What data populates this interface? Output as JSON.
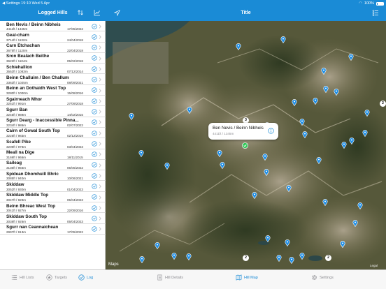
{
  "status_bar": {
    "back_app": "◀ Settings",
    "time": "19:10",
    "date": "Wed 5 Apr",
    "battery": "100%"
  },
  "left_panel": {
    "title": "Logged Hills",
    "sort_icon": "sort-arrows-icon",
    "chart_icon": "chart-icon",
    "hills": [
      {
        "name": "Ben Nevis / Beinn Nibheis",
        "height": "4411ft / 1345m",
        "date": "17/05/2022"
      },
      {
        "name": "Geal-charn",
        "height": "3714ft / 1132m",
        "date": "24/04/2018"
      },
      {
        "name": "Carn Etchachan",
        "height": "3675ft / 1120m",
        "date": "22/04/2018"
      },
      {
        "name": "Sron Bealach Beithe",
        "height": "3622ft / 1104m",
        "date": "05/02/2018"
      },
      {
        "name": "Schiehallion",
        "height": "3553ft / 1083m",
        "date": "07/12/2014"
      },
      {
        "name": "Beinn Challuim / Ben Challum",
        "height": "3363ft / 1025m",
        "date": "08/09/2021"
      },
      {
        "name": "Beinn an Dothaidh West Top",
        "height": "3280ft / 1000m",
        "date": "15/08/2016"
      },
      {
        "name": "Sgairneach Mhor",
        "height": "3251ft / 991m",
        "date": "27/09/2018"
      },
      {
        "name": "Sgurr Ban",
        "height": "3245ft / 989m",
        "date": "14/02/2015"
      },
      {
        "name": "Sgurr Dearg - Inaccessible Pinna...",
        "height": "3234ft / 986m",
        "date": "02/07/2022"
      },
      {
        "name": "Cairn of Gowal South Top",
        "height": "3225ft / 983m",
        "date": "02/12/2019"
      },
      {
        "name": "Scafell Pike",
        "height": "3209ft / 978m",
        "date": "03/04/2023"
      },
      {
        "name": "Meall na Dige",
        "height": "3169ft / 966m",
        "date": "18/11/2015"
      },
      {
        "name": "Saileag",
        "height": "3136ft / 956m",
        "date": "05/05/2022"
      },
      {
        "name": "Spidean Dhomhuill Bhric",
        "height": "3085ft / 940m",
        "date": "10/06/2021"
      },
      {
        "name": "Skiddaw",
        "height": "3052ft / 930m",
        "date": "01/04/2023"
      },
      {
        "name": "Skiddaw Middle Top",
        "height": "3047ft / 929m",
        "date": "05/04/2023"
      },
      {
        "name": "Beinn Bhreac West Top",
        "height": "3041ft / 927m",
        "date": "22/09/2016"
      },
      {
        "name": "Skiddaw South Top",
        "height": "3038ft / 926m",
        "date": "05/04/2023"
      },
      {
        "name": "Sgurr nan Ceannaichean",
        "height": "2997ft / 913m",
        "date": "17/05/2022"
      }
    ],
    "tabs": [
      {
        "label": "Hill Lists",
        "icon": "list-icon"
      },
      {
        "label": "Targets",
        "icon": "star-icon"
      },
      {
        "label": "Log",
        "icon": "checkmark-icon",
        "active": true
      }
    ]
  },
  "right_panel": {
    "title": "Title",
    "callout": {
      "name": "Ben Nevis / Beinn Nibheis",
      "height": "4411ft / 1345m"
    },
    "clusters": [
      "3",
      "2",
      "2",
      "2"
    ],
    "maps_label": "Maps",
    "legal_label": "Legal",
    "tabs": [
      {
        "label": "Hill Details",
        "icon": "document-icon"
      },
      {
        "label": "Hill Map",
        "icon": "map-icon",
        "active": true
      },
      {
        "label": "Settings",
        "icon": "gear-icon"
      }
    ]
  },
  "colors": {
    "accent": "#1a8bd6",
    "tab_inactive": "#8e8e93",
    "pin": "#1e8ee6",
    "selected": "#34c759"
  }
}
